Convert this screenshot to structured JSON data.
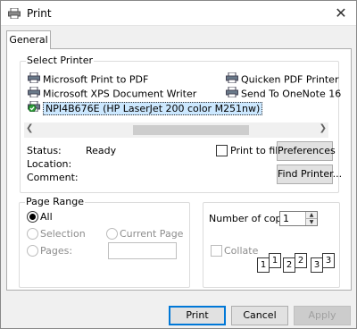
{
  "window": {
    "title": "Print"
  },
  "tabs": [
    {
      "label": "General"
    }
  ],
  "select_printer": {
    "title": "Select Printer",
    "printers": [
      {
        "label": "Microsoft Print to PDF"
      },
      {
        "label": "Microsoft XPS Document Writer"
      },
      {
        "label": "NPI4B676E (HP LaserJet 200 color M251nw)",
        "selected": true
      },
      {
        "label": "Quicken PDF Printer"
      },
      {
        "label": "Send To OneNote 16"
      }
    ],
    "status_label": "Status:",
    "status_value": "Ready",
    "location_label": "Location:",
    "comment_label": "Comment:",
    "print_to_file_label": "Print to file",
    "preferences_button": "Preferences",
    "find_printer_button": "Find Printer..."
  },
  "page_range": {
    "title": "Page Range",
    "all_label": "All",
    "selection_label": "Selection",
    "current_page_label": "Current Page",
    "pages_label": "Pages:",
    "pages_value": ""
  },
  "copies": {
    "number_label": "Number of copies:",
    "number_value": "1",
    "collate_label": "Collate",
    "collate_pages": [
      "1",
      "1",
      "2",
      "2",
      "3",
      "3"
    ]
  },
  "footer": {
    "print_button": "Print",
    "cancel_button": "Cancel",
    "apply_button": "Apply"
  }
}
